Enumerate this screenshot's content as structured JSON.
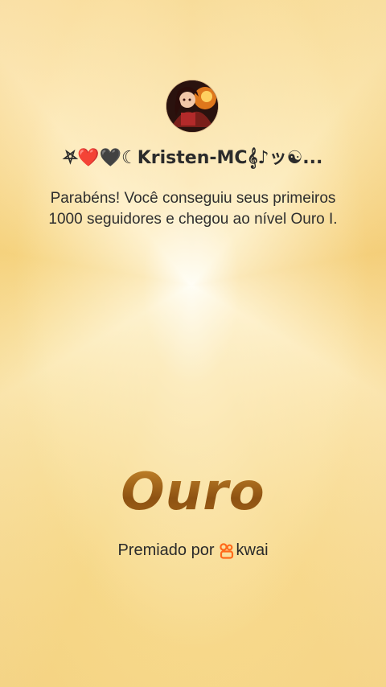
{
  "profile": {
    "username": "⛧❤️🖤☾Kristen-MC𝄞♪ッ☯...",
    "avatar_icon": "profile-avatar"
  },
  "message": {
    "text": "Parabéns! Você conseguiu seus primeiros 1000 seguidores e chegou ao nível Ouro I."
  },
  "level": {
    "title": "Ouro"
  },
  "footer": {
    "awarded_by": "Premiado por",
    "brand": "kwai",
    "brand_icon": "kwai-logo-icon",
    "brand_color": "#ff6a1a"
  },
  "colors": {
    "background": "#f8dc92",
    "gold_text": "#a8661a"
  }
}
